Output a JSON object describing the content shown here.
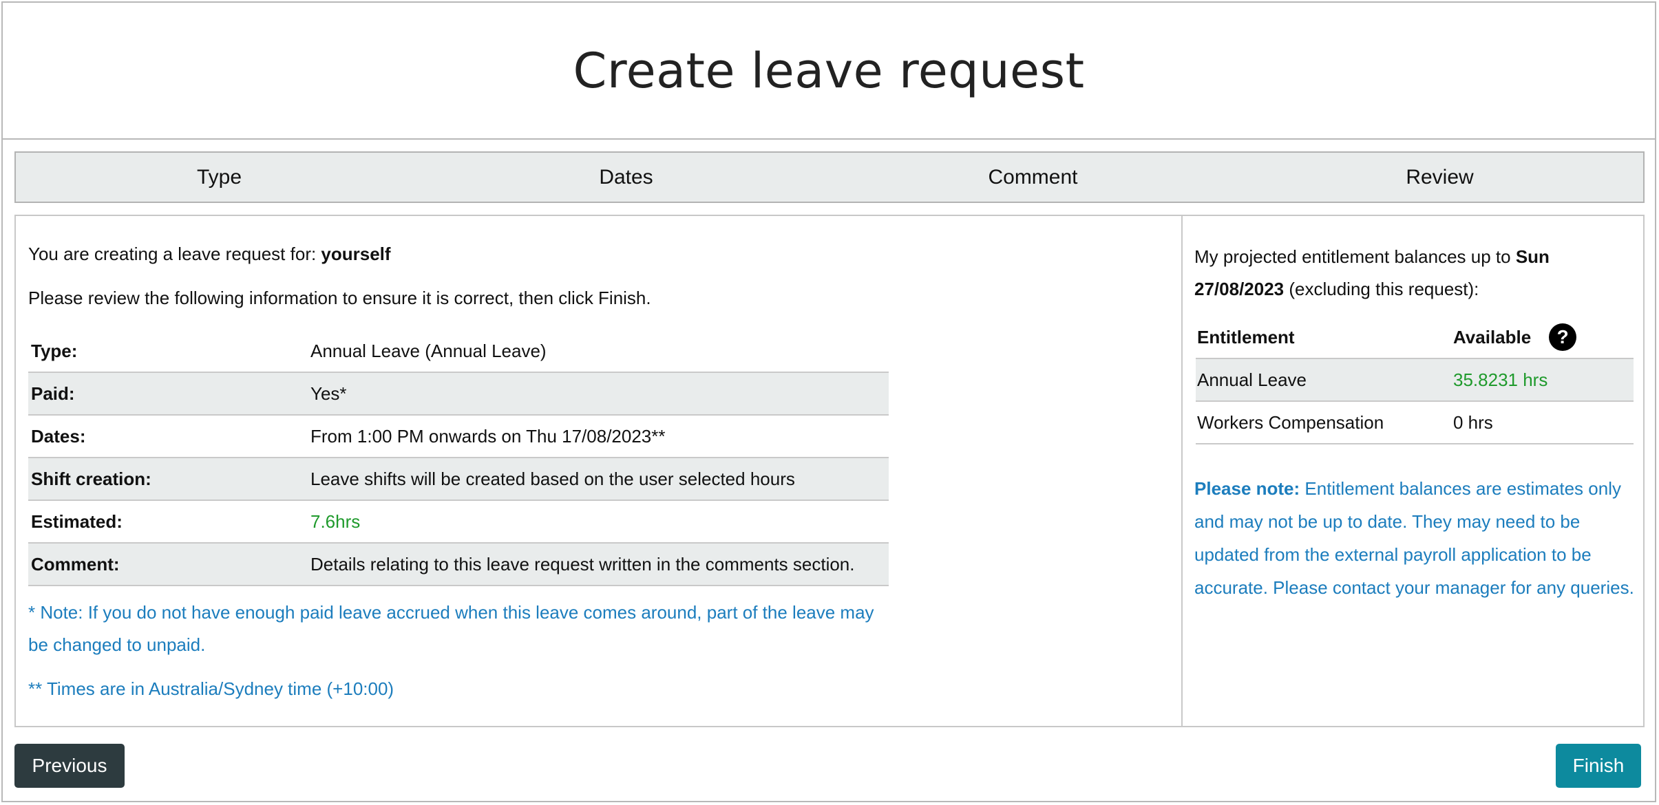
{
  "header": {
    "title": "Create leave request"
  },
  "steps": [
    "Type",
    "Dates",
    "Comment",
    "Review"
  ],
  "review": {
    "intro_prefix": "You are creating a leave request for: ",
    "intro_subject": "yourself",
    "instruction": "Please review the following information to ensure it is correct, then click Finish.",
    "rows": [
      {
        "label": "Type:",
        "value": "Annual Leave (Annual Leave)"
      },
      {
        "label": "Paid:",
        "value": "Yes*"
      },
      {
        "label": "Dates:",
        "value": "From 1:00 PM onwards on Thu 17/08/2023**"
      },
      {
        "label": "Shift creation:",
        "value": "Leave shifts will be created based on the user selected hours"
      },
      {
        "label": "Estimated:",
        "value": "7.6hrs"
      },
      {
        "label": "Comment:",
        "value": "Details relating to this leave request written in the comments section."
      }
    ],
    "note_paid": "* Note: If you do not have enough paid leave accrued when this leave comes around, part of the leave may be changed to unpaid.",
    "note_time": "** Times are in Australia/Sydney time (+10:00)"
  },
  "balances": {
    "intro_prefix": "My projected entitlement balances up to ",
    "intro_date": "Sun 27/08/2023",
    "intro_suffix": " (excluding this request):",
    "col_entitlement": "Entitlement",
    "col_available": "Available",
    "help_icon": "?",
    "rows": [
      {
        "name": "Annual Leave",
        "available": "35.8231 hrs"
      },
      {
        "name": "Workers Compensation",
        "available": "0 hrs"
      }
    ],
    "note_label": "Please note:",
    "note_text": " Entitlement balances are estimates only and may not be up to date. They may need to be updated from the external payroll application to be accurate. Please contact your manager for any queries."
  },
  "buttons": {
    "previous": "Previous",
    "finish": "Finish"
  },
  "colors": {
    "accent": "#0d8a9e",
    "note_blue": "#1c7dbd",
    "green": "#1f9a2c",
    "dark_button": "#2d3b3f"
  }
}
